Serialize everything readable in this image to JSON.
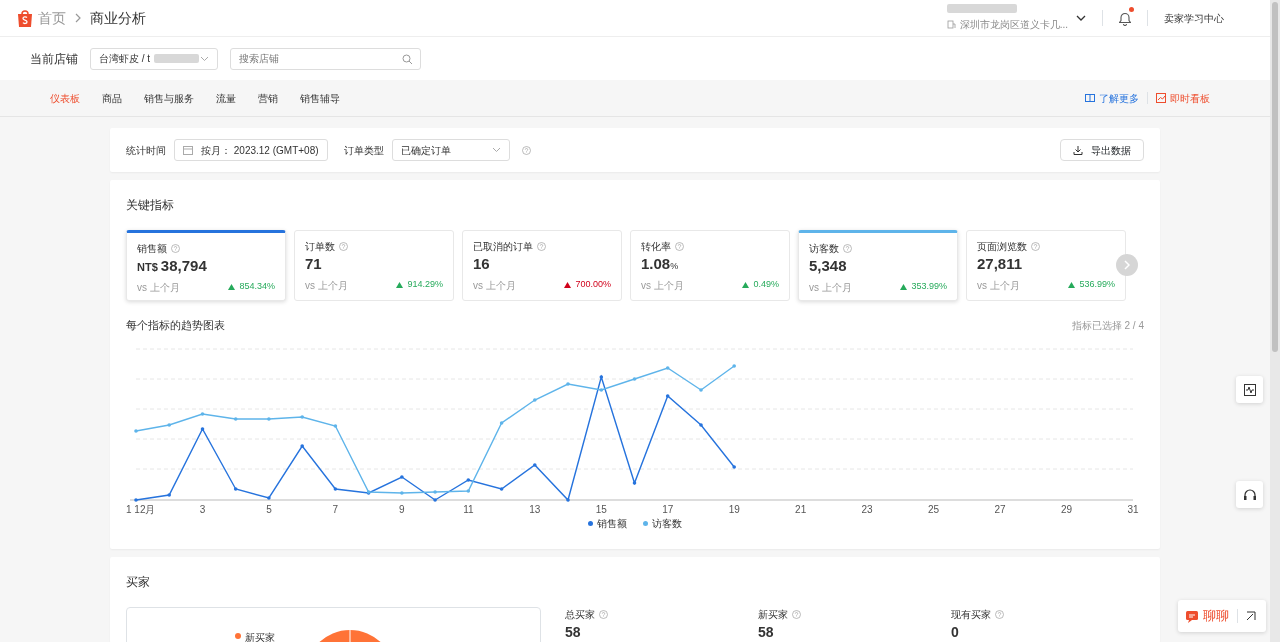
{
  "breadcrumb": [
    {
      "label": "首页"
    },
    {
      "label": "商业分析"
    }
  ],
  "account": {
    "address": "深圳市龙岗区道义卡几..."
  },
  "notification": {
    "unread": true
  },
  "header_link": "卖家学习中心",
  "store": {
    "label": "当前店铺",
    "value": "台湾虾皮 / t",
    "search_placeholder": "搜索店铺"
  },
  "tabs": [
    {
      "label": "仪表板",
      "selected": true
    },
    {
      "label": "商品",
      "selected": false
    },
    {
      "label": "销售与服务",
      "selected": false
    },
    {
      "label": "流量",
      "selected": false
    },
    {
      "label": "营销",
      "selected": false
    },
    {
      "label": "销售辅导",
      "selected": false
    }
  ],
  "nav_links": [
    {
      "label": "了解更多",
      "kind": "info"
    },
    {
      "label": "即时看板",
      "kind": "live"
    }
  ],
  "filters": {
    "time_label": "统计时间",
    "time_value": "按月： 2023.12 (GMT+08)",
    "order_label": "订单类型",
    "order_value": "已确定订单",
    "export": "导出数据"
  },
  "key_metrics": {
    "title": "关键指标",
    "cards": [
      {
        "name": "销售额",
        "prefix": "NT$",
        "value": "38,794",
        "compare": "vs 上个月",
        "change": "854.34%",
        "negative": false,
        "selected": true,
        "color": "#2673dd"
      },
      {
        "name": "订单数",
        "value": "71",
        "compare": "vs 上个月",
        "change": "914.29%",
        "negative": false,
        "selected": false
      },
      {
        "name": "已取消的订单",
        "value": "16",
        "compare": "vs 上个月",
        "change": "700.00%",
        "negative": true,
        "selected": false
      },
      {
        "name": "转化率",
        "value": "1.08",
        "unit": "%",
        "compare": "vs 上个月",
        "change": "0.49%",
        "negative": false,
        "selected": false
      },
      {
        "name": "访客数",
        "value": "5,348",
        "compare": "vs 上个月",
        "change": "353.99%",
        "negative": false,
        "selected": true,
        "color": "#5eb4ea"
      },
      {
        "name": "页面浏览数",
        "value": "27,811",
        "compare": "vs 上个月",
        "change": "536.99%",
        "negative": false,
        "selected": false
      }
    ]
  },
  "trend": {
    "title": "每个指标的趋势图表",
    "selected_count": "指标已选择 2 / 4",
    "x_labels": [
      "1 12月",
      "3",
      "5",
      "7",
      "9",
      "11",
      "13",
      "15",
      "17",
      "19",
      "21",
      "23",
      "25",
      "27",
      "29",
      "31"
    ],
    "legend": [
      {
        "label": "销售额",
        "color": "#2673dd"
      },
      {
        "label": "访客数",
        "color": "#5eb4ea"
      }
    ]
  },
  "buyers": {
    "title": "买家",
    "legend": [
      {
        "label": "新买家",
        "color": "#ff7337"
      }
    ],
    "stats": [
      {
        "label": "总买家",
        "value": "58"
      },
      {
        "label": "新买家",
        "value": "58"
      },
      {
        "label": "现有买家",
        "value": "0"
      }
    ]
  },
  "chat": {
    "label": "聊聊"
  }
}
